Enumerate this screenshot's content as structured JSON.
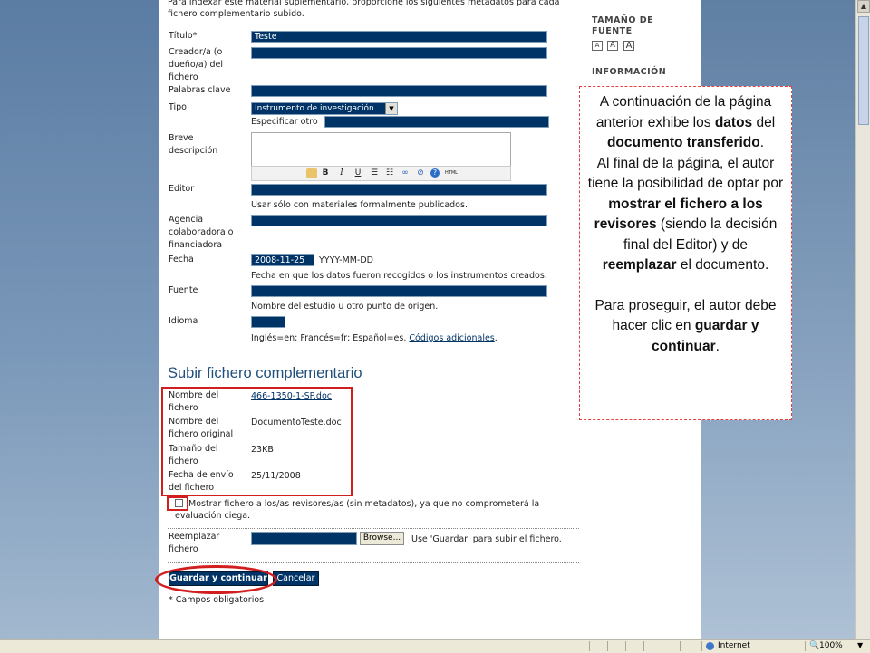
{
  "intro": {
    "line1": "Para indexar este material suplementario, proporcione los siguientes metadatos para cada",
    "line2": "fichero complementario subido."
  },
  "form": {
    "title_label": "Título*",
    "title_value": "Teste",
    "creator_label": "Creador/a (o dueño/a) del fichero",
    "keywords_label": "Palabras clave",
    "type_label": "Tipo",
    "type_value": "Instrumento de investigación",
    "type_other_label": "Especificar otro",
    "description_label": "Breve descripción",
    "publisher_label": "Editor",
    "publisher_hint": "Usar sólo con materiales formalmente publicados.",
    "sponsor_label": "Agencia colaboradora o financiadora",
    "date_label": "Fecha",
    "date_value": "2008-11-25",
    "date_format": "YYYY-MM-DD",
    "date_hint": "Fecha en que los datos fueron recogidos o los instrumentos creados.",
    "source_label": "Fuente",
    "source_hint": "Nombre del estudio u otro punto de origen.",
    "language_label": "Idioma",
    "language_hint": "Inglés=en; Francés=fr; Español=es.",
    "language_link": "Códigos adicionales",
    "language_hint_end": "."
  },
  "editor_toolbar": [
    "paste-icon",
    "bold-icon",
    "italic-icon",
    "underline-icon",
    "bullet-list-icon",
    "numbered-list-icon",
    "link-icon",
    "unlink-icon",
    "help-icon",
    "html-icon"
  ],
  "editor_toolbar_text": {
    "bold": "B",
    "italic": "I",
    "underline": "U",
    "html": "HTML"
  },
  "upload": {
    "section_title": "Subir fichero complementario",
    "filename_label": "Nombre del fichero",
    "filename_value": "466-1350-1-SP.doc",
    "original_label": "Nombre del fichero original",
    "original_value": "DocumentoTeste.doc",
    "size_label": "Tamaño del fichero",
    "size_value": "23KB",
    "upload_date_label": "Fecha de envío del fichero",
    "upload_date_value": "25/11/2008",
    "show_reviewers_line1": "Mostrar fichero a los/as revisores/as (sin metadatos), ya que no comprometerá la",
    "show_reviewers_line2": "evaluación ciega.",
    "show_reviewers_checked": false,
    "replace_label": "Reemplazar fichero",
    "browse_button": "Browse...",
    "replace_hint": "Use 'Guardar' para subir el fichero."
  },
  "actions": {
    "save_continue": "Guardar y continuar",
    "cancel": "Cancelar",
    "required_note": "* Campos obligatorios"
  },
  "sidebar": {
    "font_size_heading": "TAMAÑO DE FUENTE",
    "font_buttons": [
      "A",
      "A",
      "A"
    ],
    "info_heading": "INFORMACIÓN"
  },
  "callout": {
    "p1_a": "A continuación de la página anterior exhibe los ",
    "p1_b1": "datos",
    "p1_c": " del ",
    "p1_b2": "documento transferido",
    "p1_d": ".",
    "p2_a": "Al final de la página, el autor tiene la posibilidad de optar por ",
    "p2_b1": "mostrar el fichero a los revisores",
    "p2_c": " (siendo la decisión final del Editor) y de ",
    "p2_b2": "reemplazar",
    "p2_d": " el documento.",
    "p3_a": "Para proseguir, el autor debe hacer clic en ",
    "p3_b": "guardar y continuar",
    "p3_c": "."
  },
  "statusbar": {
    "zone": "Internet",
    "zoom": "100%"
  },
  "colors": {
    "field_fill": "#003366",
    "section_title": "#1f4f7a",
    "highlight_red": "#d11e1e",
    "background_blue": "#5f7fa3"
  }
}
